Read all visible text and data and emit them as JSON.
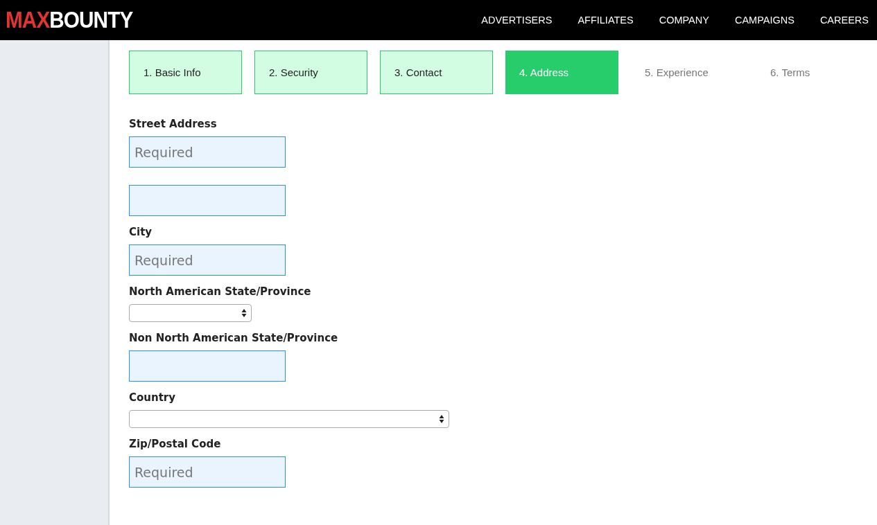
{
  "header": {
    "logo_accent": "MAX",
    "logo_rest": "BOUNTY",
    "nav": [
      "ADVERTISERS",
      "AFFILIATES",
      "COMPANY",
      "CAMPAIGNS",
      "CAREERS"
    ]
  },
  "steps": [
    {
      "label": "1. Basic Info",
      "completed": true,
      "selected": false
    },
    {
      "label": "2. Security",
      "completed": true,
      "selected": false
    },
    {
      "label": "3. Contact",
      "completed": true,
      "selected": false
    },
    {
      "label": "4. Address",
      "completed": false,
      "selected": true
    },
    {
      "label": "5. Experience",
      "completed": false,
      "selected": false
    },
    {
      "label": "6. Terms",
      "completed": false,
      "selected": false
    }
  ],
  "fields": [
    {
      "label": "Street Address",
      "kind": "text",
      "placeholder": "Required"
    },
    {
      "kind": "text"
    },
    {
      "label": "City",
      "kind": "text",
      "placeholder": "Required"
    },
    {
      "label": "North American State/Province",
      "kind": "select"
    },
    {
      "label": "Non North American State/Province",
      "kind": "text"
    },
    {
      "label": "Country",
      "kind": "select"
    },
    {
      "label": "Zip/Postal Code",
      "kind": "text",
      "placeholder": "Required"
    }
  ]
}
